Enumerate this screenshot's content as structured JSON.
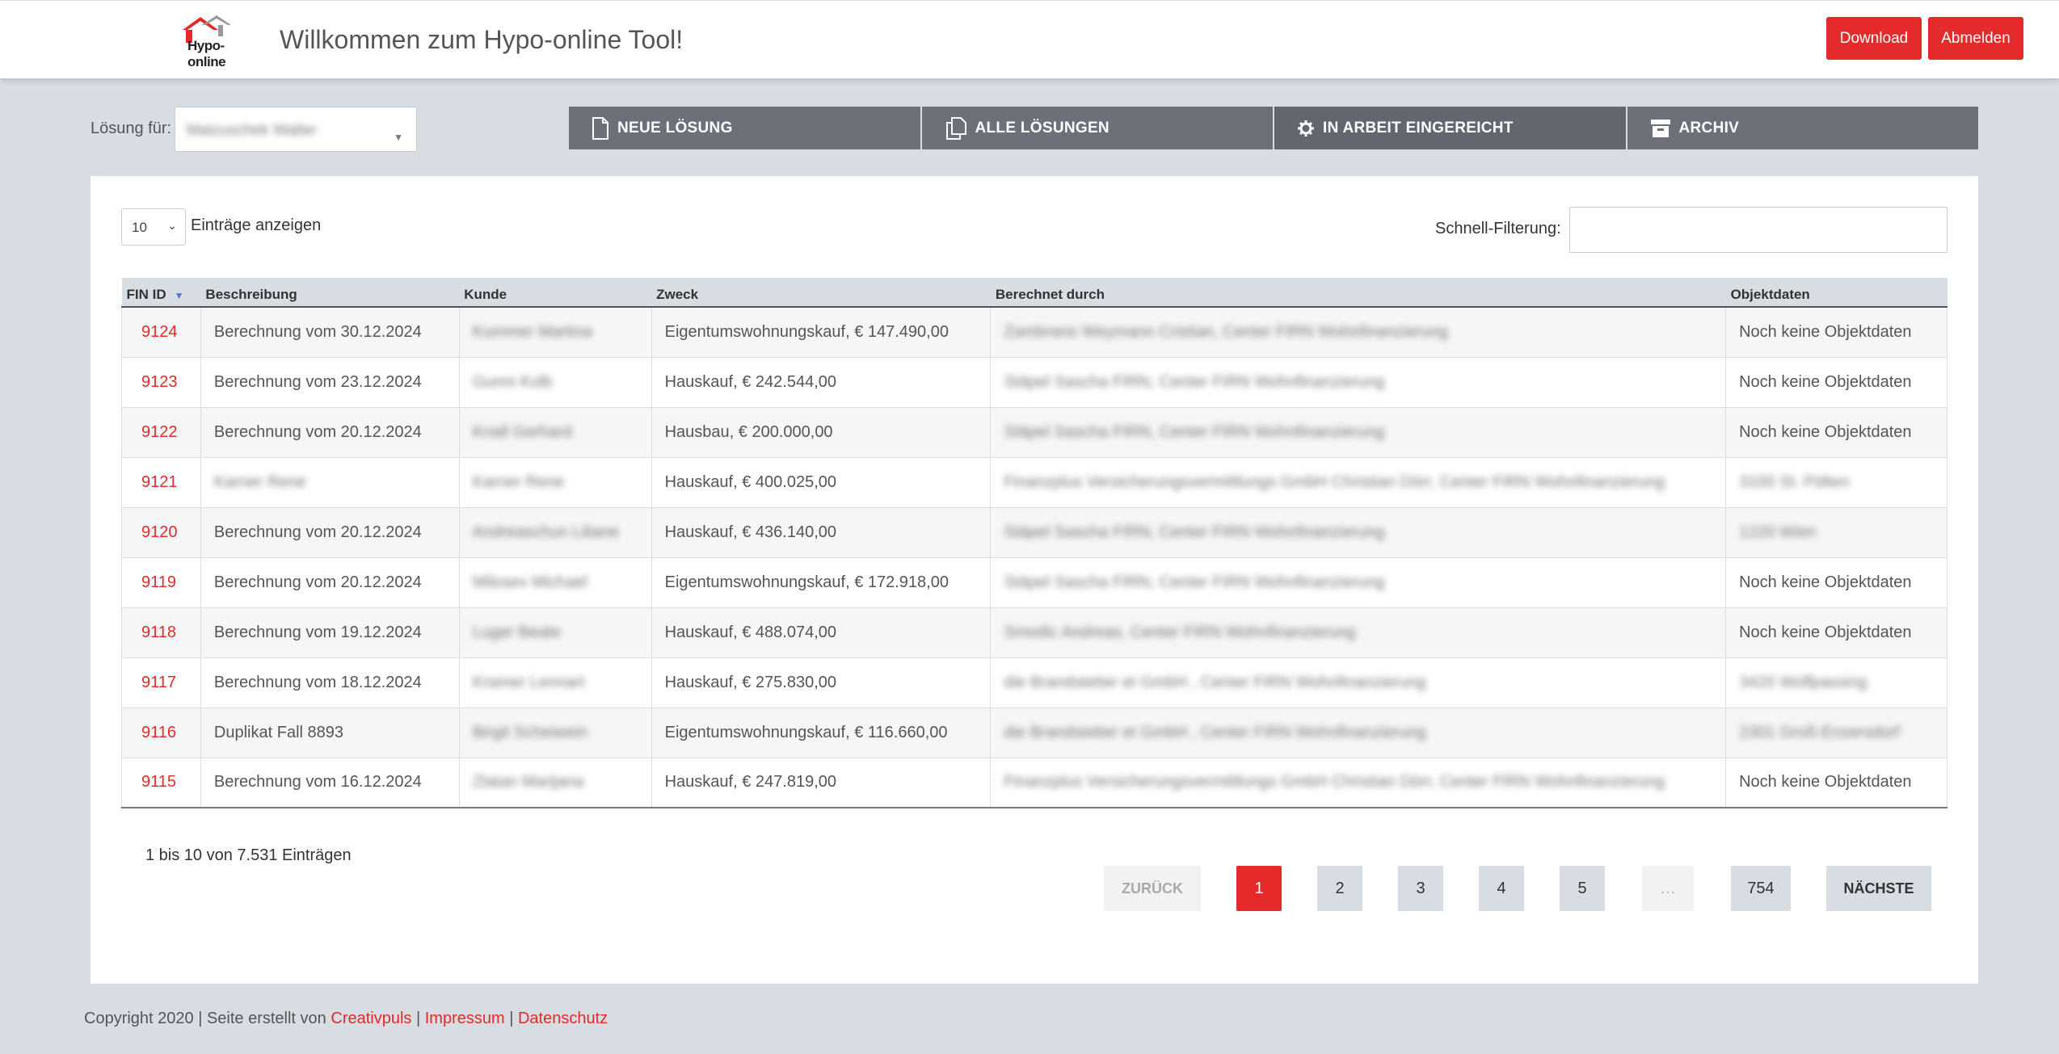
{
  "header": {
    "logo_text": "Hypo-online",
    "title": "Willkommen zum Hypo-online Tool!",
    "download_label": "Download",
    "logout_label": "Abmelden"
  },
  "solution": {
    "label": "Lösung für:",
    "value": "Matzuschek Walter"
  },
  "tabs": [
    {
      "label": "NEUE LÖSUNG",
      "icon": "document-icon"
    },
    {
      "label": "ALLE LÖSUNGEN",
      "icon": "copy-icon"
    },
    {
      "label": "IN ARBEIT EINGEREICHT",
      "icon": "gear-icon"
    },
    {
      "label": "ARCHIV",
      "icon": "archive-icon"
    }
  ],
  "table_controls": {
    "length_value": "10",
    "length_label": "Einträge anzeigen",
    "filter_label": "Schnell-Filterung:",
    "filter_value": ""
  },
  "table": {
    "columns": [
      "FIN ID",
      "Beschreibung",
      "Kunde",
      "Zweck",
      "Berechnet durch",
      "Objektdaten"
    ],
    "rows": [
      {
        "id": "9124",
        "desc": "Berechnung vom 30.12.2024",
        "customer": "Kummer Martina",
        "purpose": "Eigentumswohnungskauf, € 147.490,00",
        "by": "Zambrano Weymann Cristian, Center FIRN Wohnfinanzierung",
        "obj": "Noch keine Objektdaten"
      },
      {
        "id": "9123",
        "desc": "Berechnung vom 23.12.2024",
        "customer": "Gunni Kolb",
        "purpose": "Hauskauf, € 242.544,00",
        "by": "Stäpel Sascha FIRN, Center FIRN Wohnfinanzierung",
        "obj": "Noch keine Objektdaten"
      },
      {
        "id": "9122",
        "desc": "Berechnung vom 20.12.2024",
        "customer": "Knall Gerhard",
        "purpose": "Hausbau, € 200.000,00",
        "by": "Stäpel Sascha FIRN, Center FIRN Wohnfinanzierung",
        "obj": "Noch keine Objektdaten"
      },
      {
        "id": "9121",
        "desc": "Karner Rene",
        "customer": "Karner Rene",
        "purpose": "Hauskauf, € 400.025,00",
        "by": "Finanzplus Versicherungsvermittlungs GmbH Christian Dörr, Center FIRN Wohnfinanzierung",
        "obj": "3100 St. Pölten"
      },
      {
        "id": "9120",
        "desc": "Berechnung vom 20.12.2024",
        "customer": "Andreaschun Liliane",
        "purpose": "Hauskauf, € 436.140,00",
        "by": "Stäpel Sascha FIRN, Center FIRN Wohnfinanzierung",
        "obj": "1220 Wien"
      },
      {
        "id": "9119",
        "desc": "Berechnung vom 20.12.2024",
        "customer": "Milosev Michael",
        "purpose": "Eigentumswohnungskauf, € 172.918,00",
        "by": "Stäpel Sascha FIRN, Center FIRN Wohnfinanzierung",
        "obj": "Noch keine Objektdaten"
      },
      {
        "id": "9118",
        "desc": "Berechnung vom 19.12.2024",
        "customer": "Luger Beate",
        "purpose": "Hauskauf, € 488.074,00",
        "by": "Smodic Andreas, Center FIRN Wohnfinanzierung",
        "obj": "Noch keine Objektdaten"
      },
      {
        "id": "9117",
        "desc": "Berechnung vom 18.12.2024",
        "customer": "Kramer Lennart",
        "purpose": "Hauskauf, € 275.830,00",
        "by": "die Brandstetter et GmbH , Center FIRN Wohnfinanzierung",
        "obj": "3420 Wolfpassing"
      },
      {
        "id": "9116",
        "desc": "Duplikat Fall 8893",
        "customer": "Birgit Scheiwein",
        "purpose": "Eigentumswohnungskauf, € 116.660,00",
        "by": "die Brandstetter et GmbH , Center FIRN Wohnfinanzierung",
        "obj": "2301 Groß-Enzersdorf"
      },
      {
        "id": "9115",
        "desc": "Berechnung vom 16.12.2024",
        "customer": "Zlatan Marijana",
        "purpose": "Hauskauf, € 247.819,00",
        "by": "Finanzplus Versicherungsvermittlungs GmbH Christian Dörr, Center FIRN Wohnfinanzierung",
        "obj": "Noch keine Objektdaten"
      }
    ]
  },
  "pagination": {
    "info": "1 bis 10 von 7.531 Einträgen",
    "prev": "ZURÜCK",
    "pages": [
      "1",
      "2",
      "3",
      "4",
      "5"
    ],
    "dots": "…",
    "last": "754",
    "next": "NÄCHSTE",
    "current": "1"
  },
  "footer": {
    "copyright": "Copyright 2020 | Seite erstellt von ",
    "link1": "Creativpuls",
    "sep": " | ",
    "link2": "Impressum",
    "link3": "Datenschutz"
  },
  "colors": {
    "accent": "#e42a2a",
    "tab_bg": "#6b7079",
    "page_bg": "#d8dce3"
  }
}
